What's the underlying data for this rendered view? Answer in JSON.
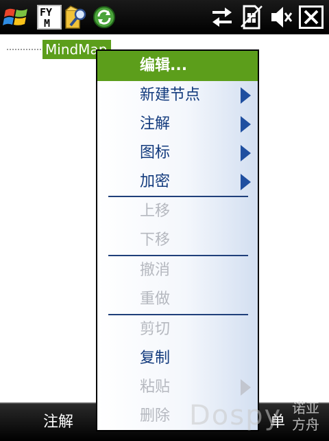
{
  "taskbar": {
    "icons": [
      "windows-start-icon",
      "fym-app-icon",
      "search-key-icon",
      "sync-icon",
      "data-connection-icon",
      "sim-card-icon",
      "volume-muted-icon",
      "close-icon"
    ],
    "fym_text": "FY M"
  },
  "tree": {
    "root_label": "MindMap"
  },
  "menu": {
    "header": "编辑...",
    "items": [
      {
        "label": "新建节点",
        "enabled": true,
        "submenu": true
      },
      {
        "label": "注解",
        "enabled": true,
        "submenu": true
      },
      {
        "label": "图标",
        "enabled": true,
        "submenu": true
      },
      {
        "label": "加密",
        "enabled": true,
        "submenu": true
      },
      {
        "label": "上移",
        "enabled": false,
        "submenu": false
      },
      {
        "label": "下移",
        "enabled": false,
        "submenu": false
      },
      {
        "label": "撤消",
        "enabled": false,
        "submenu": false
      },
      {
        "label": "重做",
        "enabled": false,
        "submenu": false
      },
      {
        "label": "剪切",
        "enabled": false,
        "submenu": false
      },
      {
        "label": "复制",
        "enabled": true,
        "submenu": false
      },
      {
        "label": "粘贴",
        "enabled": false,
        "submenu": true
      },
      {
        "label": "删除",
        "enabled": false,
        "submenu": false
      }
    ]
  },
  "softkeys": {
    "left": "注解",
    "right": "单"
  },
  "watermark": {
    "latin": "Dospy",
    "cjk_line1": "诺亚",
    "cjk_line2": "方舟"
  },
  "colors": {
    "accent_green": "#5c9e1b",
    "menu_text": "#123a7d",
    "disabled_text": "#b5b8bf"
  }
}
